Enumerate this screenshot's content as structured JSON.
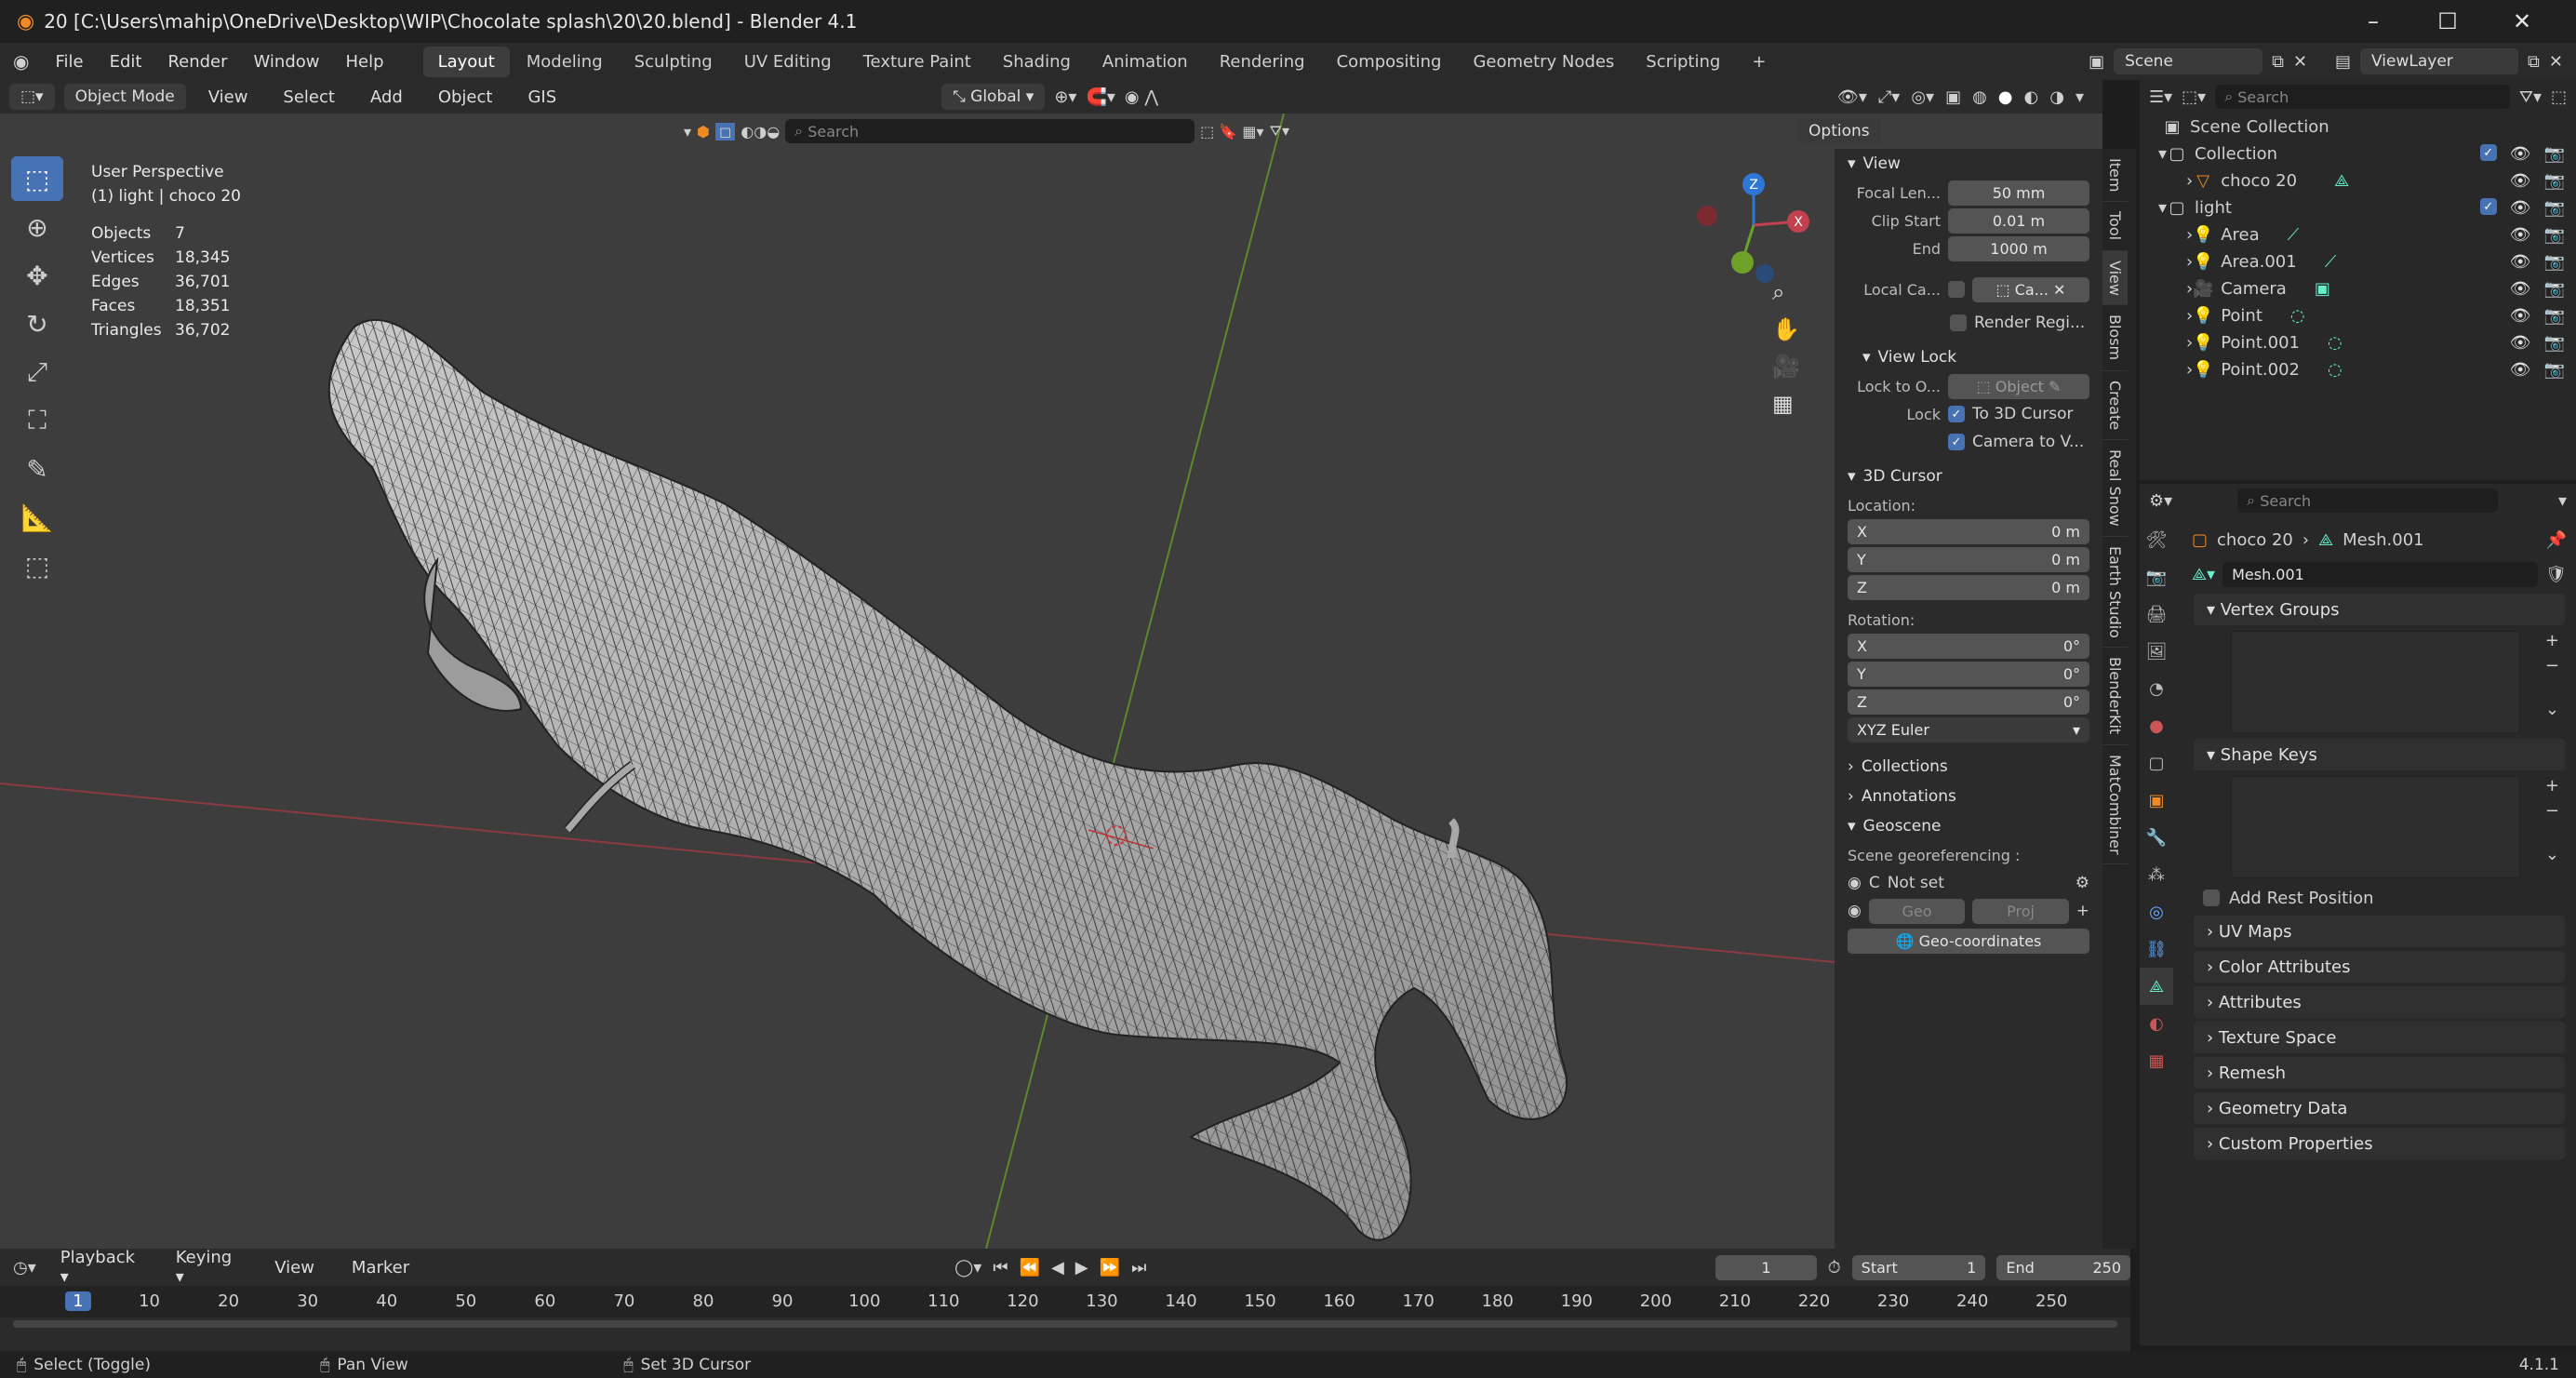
{
  "window": {
    "title": "20 [C:\\Users\\mahip\\OneDrive\\Desktop\\WIP\\Chocolate splash\\20\\20.blend] - Blender 4.1",
    "controls": [
      "–",
      "☐",
      "✕"
    ]
  },
  "menu": [
    "File",
    "Edit",
    "Render",
    "Window",
    "Help"
  ],
  "workspaces": [
    "Layout",
    "Modeling",
    "Sculpting",
    "UV Editing",
    "Texture Paint",
    "Shading",
    "Animation",
    "Rendering",
    "Compositing",
    "Geometry Nodes",
    "Scripting"
  ],
  "active_workspace": "Layout",
  "scene": "Scene",
  "view_layer": "ViewLayer",
  "viewport_header": {
    "mode": "Object Mode",
    "menus": [
      "View",
      "Select",
      "Add",
      "Object",
      "GIS"
    ],
    "transform": "Global",
    "search_placeholder": "Search",
    "options": "Options"
  },
  "overlay": {
    "perspective": "User Perspective",
    "context": "(1) light | choco 20",
    "stats": [
      {
        "k": "Objects",
        "v": "7"
      },
      {
        "k": "Vertices",
        "v": "18,345"
      },
      {
        "k": "Edges",
        "v": "36,701"
      },
      {
        "k": "Faces",
        "v": "18,351"
      },
      {
        "k": "Triangles",
        "v": "36,702"
      }
    ]
  },
  "gizmo": {
    "z": "Z",
    "x": "X"
  },
  "npanel": {
    "view_title": "View",
    "focal_label": "Focal Len...",
    "focal": "50 mm",
    "clip_start_label": "Clip Start",
    "clip_start": "0.01 m",
    "end_label": "End",
    "end": "1000 m",
    "local_cam_label": "Local Ca...",
    "local_cam": "Ca...",
    "render_region": "Render Regi...",
    "view_lock_title": "View Lock",
    "lock_to_label": "Lock to O...",
    "lock_to": "Object",
    "lock_label": "Lock",
    "lock_3d": "To 3D Cursor",
    "lock_cam": "Camera to V...",
    "cursor_title": "3D Cursor",
    "location_label": "Location:",
    "loc": [
      {
        "a": "X",
        "v": "0 m"
      },
      {
        "a": "Y",
        "v": "0 m"
      },
      {
        "a": "Z",
        "v": "0 m"
      }
    ],
    "rotation_label": "Rotation:",
    "rot": [
      {
        "a": "X",
        "v": "0°"
      },
      {
        "a": "Y",
        "v": "0°"
      },
      {
        "a": "Z",
        "v": "0°"
      }
    ],
    "rot_mode": "XYZ Euler",
    "collections": "Collections",
    "annotations": "Annotations",
    "geoscene": "Geoscene",
    "georef_label": "Scene georeferencing :",
    "c_label": "C",
    "not_set": "Not set",
    "geo": "Geo",
    "proj": "Proj",
    "geocoords": "Geo-coordinates"
  },
  "side_tabs": [
    "Item",
    "Tool",
    "View",
    "Blosm",
    "Create",
    "Real Snow",
    "Earth Studio",
    "BlenderKit",
    "MatCombiner"
  ],
  "outliner": {
    "search_placeholder": "Search",
    "rows": [
      {
        "name": "Scene Collection",
        "indent": 0
      },
      {
        "name": "Collection",
        "indent": 1
      },
      {
        "name": "choco 20",
        "indent": 2
      },
      {
        "name": "light",
        "indent": 1
      },
      {
        "name": "Area",
        "indent": 2
      },
      {
        "name": "Area.001",
        "indent": 2
      },
      {
        "name": "Camera",
        "indent": 2
      },
      {
        "name": "Point",
        "indent": 2
      },
      {
        "name": "Point.001",
        "indent": 2
      },
      {
        "name": "Point.002",
        "indent": 2
      }
    ]
  },
  "properties": {
    "search_placeholder": "Search",
    "breadcrumb_obj": "choco 20",
    "breadcrumb_mesh": "Mesh.001",
    "mesh_name": "Mesh.001",
    "vertex_groups": "Vertex Groups",
    "shape_keys": "Shape Keys",
    "add_rest": "Add Rest Position",
    "sections": [
      "UV Maps",
      "Color Attributes",
      "Attributes",
      "Texture Space",
      "Remesh",
      "Geometry Data",
      "Custom Properties"
    ]
  },
  "timeline": {
    "menus": [
      "Playback",
      "Keying",
      "View",
      "Marker"
    ],
    "current_frame": "1",
    "start_label": "Start",
    "start": "1",
    "end_label": "End",
    "end": "250",
    "ticks": [
      "1",
      "10",
      "20",
      "30",
      "40",
      "50",
      "60",
      "70",
      "80",
      "90",
      "100",
      "110",
      "120",
      "130",
      "140",
      "150",
      "160",
      "170",
      "180",
      "190",
      "200",
      "210",
      "220",
      "230",
      "240",
      "250"
    ]
  },
  "status": {
    "select": "Select (Toggle)",
    "pan": "Pan View",
    "cursor": "Set 3D Cursor",
    "version": "4.1.1"
  },
  "colors": {
    "accent": "#4772b3",
    "viewport_bg": "#3d3d3d",
    "x_axis": "#c2414f",
    "y_axis": "#6ea128",
    "z_axis": "#2f77d6"
  }
}
